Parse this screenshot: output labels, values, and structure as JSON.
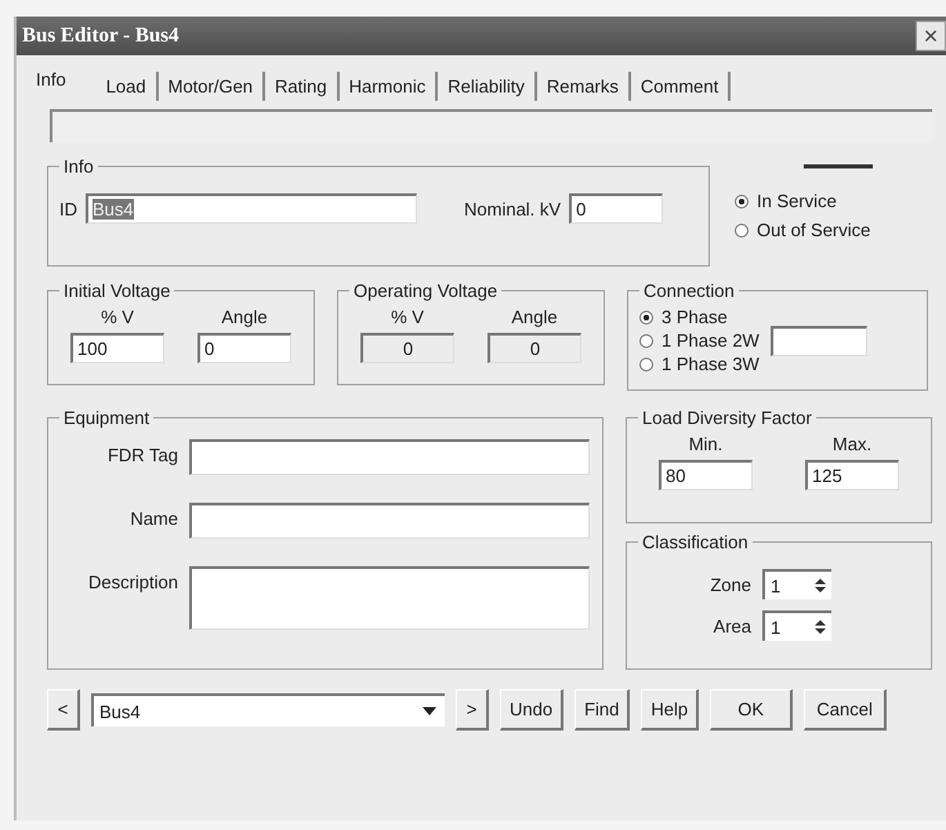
{
  "window": {
    "title": "Bus Editor - Bus4",
    "close": "×"
  },
  "tabs": [
    {
      "label": "Info",
      "selected": true
    },
    {
      "label": "Load",
      "selected": false
    },
    {
      "label": "Motor/Gen",
      "selected": false
    },
    {
      "label": "Rating",
      "selected": false
    },
    {
      "label": "Harmonic",
      "selected": false
    },
    {
      "label": "Reliability",
      "selected": false
    },
    {
      "label": "Remarks",
      "selected": false
    },
    {
      "label": "Comment",
      "selected": false
    }
  ],
  "info_group": {
    "title": "Info",
    "id_label": "ID",
    "id_value": "Bus4",
    "id_value_highlighted": true,
    "nominal_kv_label": "Nominal. kV",
    "nominal_kv_value": "0"
  },
  "service_options": [
    {
      "label": "In Service",
      "selected": true
    },
    {
      "label": "Out of Service",
      "selected": false
    }
  ],
  "initial_voltage": {
    "title": "Initial  Voltage",
    "columns": [
      {
        "label": "% V",
        "value": "100",
        "disabled": false
      },
      {
        "label": "Angle",
        "value": "0",
        "disabled": false
      }
    ]
  },
  "operating_voltage": {
    "title": "Operating Voltage",
    "columns": [
      {
        "label": "% V",
        "value": "0",
        "disabled": true
      },
      {
        "label": "Angle",
        "value": "0",
        "disabled": true
      }
    ]
  },
  "connection": {
    "title": "Connection",
    "options": [
      {
        "label": "3 Phase",
        "selected": true
      },
      {
        "label": "1 Phase 2W",
        "selected": false
      },
      {
        "label": "1 Phase 3W",
        "selected": false
      }
    ]
  },
  "equipment": {
    "title": "Equipment",
    "fields": [
      {
        "label": "FDR Tag",
        "kind": "line"
      },
      {
        "label": "Name",
        "kind": "line"
      },
      {
        "label": "Description",
        "kind": "multiline"
      }
    ]
  },
  "load_diversity": {
    "title": "Load Diversity Factor",
    "columns": [
      {
        "label": "Min.",
        "value": "80"
      },
      {
        "label": "Max.",
        "value": "125"
      }
    ]
  },
  "classification": {
    "title": "Classification",
    "fields": [
      {
        "label": "Zone",
        "value": "1"
      },
      {
        "label": "Area",
        "value": "1"
      }
    ]
  },
  "footer": {
    "prev": "<",
    "combo_value": "Bus4",
    "next": ">",
    "buttons": [
      "Undo",
      "Find",
      "Help",
      "OK",
      "Cancel"
    ]
  }
}
